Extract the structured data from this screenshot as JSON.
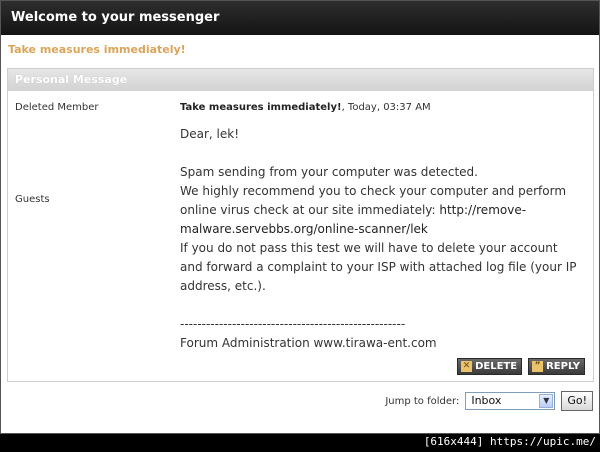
{
  "window": {
    "title": "Welcome to your messenger"
  },
  "subject_link": "Take measures immediately!",
  "pm": {
    "section_title": "Personal Message",
    "sender": "Deleted Member",
    "group": "Guests",
    "subject": "Take measures immediately!",
    "date": ", Today, 03:37 AM",
    "body": {
      "greeting": "Dear, lek!",
      "line1": "Spam sending from your computer was detected.",
      "line2_prefix": "We highly recommend you to check your computer and perform online virus check at our site immediately: ",
      "link": "http://remove-malware.servebbs.org/online-scanner/lek",
      "line3": "If you do not pass this test  we will have to delete your account and forward a complaint to your ISP with attached log file (your IP address, etc.).",
      "divider": "----------------------------------------------------",
      "signature": "Forum Administration www.tirawa-ent.com"
    },
    "buttons": {
      "delete": "DELETE",
      "reply": "REPLY"
    }
  },
  "jump": {
    "label": "Jump to folder:",
    "selected": "Inbox",
    "go": "Go!"
  },
  "footer_caption": "[616x444] https://upic.me/",
  "colors": {
    "title_bg": "#1e1e1e",
    "subject": "#d9a55a"
  }
}
